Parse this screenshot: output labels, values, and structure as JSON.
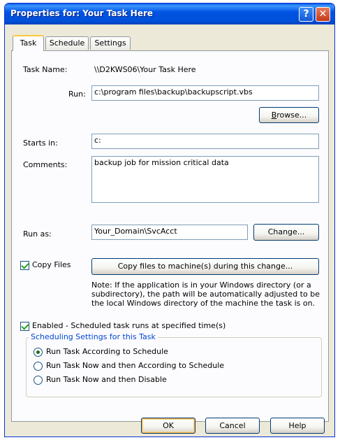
{
  "window": {
    "title": "Properties for: Your Task Here",
    "help_glyph": "?",
    "close_glyph": "✕"
  },
  "tabs": [
    {
      "label": "Task",
      "active": true
    },
    {
      "label": "Schedule",
      "active": false
    },
    {
      "label": "Settings",
      "active": false
    }
  ],
  "task": {
    "name_label": "Task Name:",
    "name_value": "\\\\D2KWS06\\Your Task Here",
    "run_label": "Run:",
    "run_value": "c:\\program files\\backup\\backupscript.vbs",
    "browse_label_pre": "",
    "browse_label_u": "B",
    "browse_label_post": "rowse...",
    "starts_in_label": "Starts in:",
    "starts_in_value": "c:",
    "comments_label": "Comments:",
    "comments_value": "backup job for mission critical data",
    "run_as_label": "Run as:",
    "run_as_value": "Your_Domain\\SvcAcct",
    "change_label": "Change...",
    "copy_files_label": "Copy Files",
    "copy_files_checked": true,
    "copy_files_button": "Copy files to machine(s) during this change...",
    "note": "Note: If the application is in your Windows directory (or a subdirectory), the path will be automatically adjusted to be the local Windows directory of the machine the task is on.",
    "enabled_label": "Enabled - Scheduled task runs at specified time(s)",
    "enabled_checked": true
  },
  "scheduling": {
    "legend": "Scheduling Settings for this Task",
    "options": [
      {
        "label": "Run Task According to Schedule",
        "selected": true
      },
      {
        "label": "Run Task Now and then According to Schedule",
        "selected": false
      },
      {
        "label": "Run Task Now and then Disable",
        "selected": false
      }
    ]
  },
  "footer": {
    "ok": "OK",
    "cancel": "Cancel",
    "help": "Help"
  }
}
